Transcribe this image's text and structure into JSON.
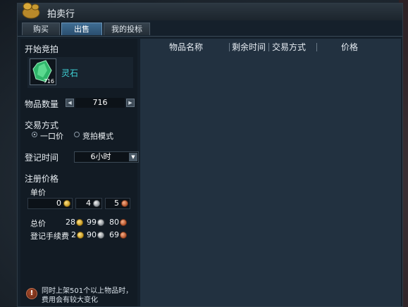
{
  "window": {
    "title": "拍卖行"
  },
  "tabs": [
    {
      "label": "购买",
      "active": false
    },
    {
      "label": "出售",
      "active": true
    },
    {
      "label": "我的投标",
      "active": false
    }
  ],
  "sell": {
    "section_title": "开始竞拍",
    "item": {
      "name": "灵石",
      "stack_count": "716",
      "icon": "green-crystal-icon"
    },
    "quantity": {
      "label": "物品数量",
      "value": "716"
    },
    "trade_method": {
      "label": "交易方式",
      "options": [
        {
          "label": "一口价",
          "selected": true
        },
        {
          "label": "竞拍模式",
          "selected": false
        }
      ]
    },
    "duration": {
      "label": "登记时间",
      "value": "6小时"
    },
    "price_section": {
      "label": "注册价格",
      "unit_price_label": "单价",
      "unit_price": {
        "gold": "0",
        "silver": "4",
        "copper": "5"
      },
      "total_label": "总价",
      "total": {
        "gold": "28",
        "silver": "99",
        "copper": "80"
      },
      "fee_label": "登记手续费",
      "fee": {
        "gold": "2",
        "silver": "90",
        "copper": "69"
      }
    },
    "warning": "同时上架501个以上物品时，费用会有较大变化"
  },
  "table": {
    "columns": [
      "物品名称",
      "剩余时间",
      "交易方式",
      "价格"
    ]
  },
  "colors": {
    "accent_tab": "#3f6d93",
    "item_name": "#3fd4d8",
    "window_bg": "#15202b"
  }
}
